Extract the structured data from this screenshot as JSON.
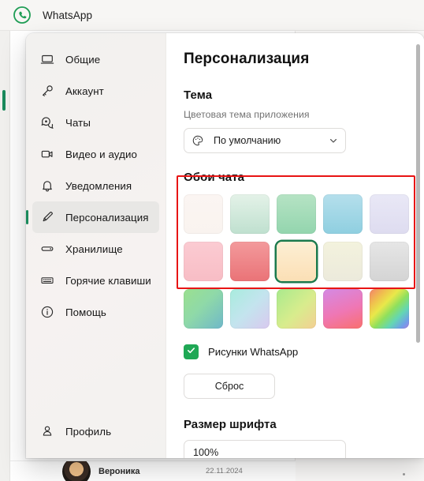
{
  "window": {
    "app_title": "WhatsApp",
    "logo_icon": "whatsapp-logo-icon"
  },
  "background": {
    "chat_name": "Вероника",
    "chat_date": "22.11.2024"
  },
  "sidebar": {
    "items": [
      {
        "label": "Общие",
        "icon": "laptop-icon",
        "active": false
      },
      {
        "label": "Аккаунт",
        "icon": "key-icon",
        "active": false
      },
      {
        "label": "Чаты",
        "icon": "chats-icon",
        "active": false
      },
      {
        "label": "Видео и аудио",
        "icon": "video-icon",
        "active": false
      },
      {
        "label": "Уведомления",
        "icon": "bell-icon",
        "active": false
      },
      {
        "label": "Персонализация",
        "icon": "brush-icon",
        "active": true
      },
      {
        "label": "Хранилище",
        "icon": "storage-icon",
        "active": false
      },
      {
        "label": "Горячие клавиши",
        "icon": "keyboard-icon",
        "active": false
      },
      {
        "label": "Помощь",
        "icon": "info-icon",
        "active": false
      }
    ],
    "profile": {
      "label": "Профиль",
      "icon": "person-icon"
    }
  },
  "content": {
    "page_title": "Персонализация",
    "theme": {
      "title": "Тема",
      "subtitle": "Цветовая тема приложения",
      "selected": "По умолчанию",
      "icon": "palette-icon",
      "caret": "chevron-down-icon"
    },
    "wallpaper": {
      "title": "Обои чата",
      "highlight_color": "#e81414",
      "selected_index": 7,
      "selected_outline": "#1b7a4d",
      "swatches": [
        {
          "name": "wallpaper-cream",
          "css": "linear-gradient(180deg,#fbf5f2 0%,#f9f3ef 100%)"
        },
        {
          "name": "wallpaper-mint",
          "css": "linear-gradient(180deg,#e4f2e8 0%,#bfe0cf 100%)"
        },
        {
          "name": "wallpaper-green",
          "css": "linear-gradient(180deg,#b6e3c4 0%,#93d5ae 100%)"
        },
        {
          "name": "wallpaper-sky",
          "css": "linear-gradient(180deg,#b5dfec 0%,#8fcfe0 100%)"
        },
        {
          "name": "wallpaper-lavender",
          "css": "linear-gradient(180deg,#e9e8f6 0%,#dedcf0 100%)"
        },
        {
          "name": "wallpaper-pink",
          "css": "linear-gradient(180deg,#fbcbd2 0%,#f8bdc5 100%)"
        },
        {
          "name": "wallpaper-coral",
          "css": "linear-gradient(180deg,#f39a9c 0%,#ea7377 100%)"
        },
        {
          "name": "wallpaper-peach",
          "css": "linear-gradient(180deg,#fdefd4 0%,#fbdfb5 100%)"
        },
        {
          "name": "wallpaper-ivory",
          "css": "linear-gradient(180deg,#f3f2dd 0%,#eceadc 100%)"
        },
        {
          "name": "wallpaper-grey",
          "css": "linear-gradient(180deg,#e6e6e6 0%,#d4d4d4 100%)"
        },
        {
          "name": "wallpaper-green-blue",
          "css": "linear-gradient(135deg,#9be08f 0%,#8fd9a8 45%,#6fb8c9 100%)"
        },
        {
          "name": "wallpaper-aqua-lilac",
          "css": "linear-gradient(135deg,#a8ecdd 0%,#c3e4ee 50%,#d9c9ef 100%)"
        },
        {
          "name": "wallpaper-lime-peach",
          "css": "linear-gradient(135deg,#a9ea8d 0%,#d8ec8d 55%,#f4cf93 100%)"
        },
        {
          "name": "wallpaper-magenta-rose",
          "css": "linear-gradient(160deg,#d48ae4 0%,#ef77b4 55%,#f9706e 100%)"
        },
        {
          "name": "wallpaper-rainbow",
          "css": "linear-gradient(135deg,#f4836a 0%,#f0c04e 22%,#e9e84a 38%,#8fe05c 55%,#63d6b4 72%,#6f9fe8 88%,#a87fe0 100%)"
        }
      ]
    },
    "whatsapp_doodles": {
      "label": "Рисунки WhatsApp",
      "checked": true,
      "check_icon": "checkmark-icon",
      "color": "#1fa855"
    },
    "reset_button": "Сброс",
    "font_size": {
      "title": "Размер шрифта",
      "selected": "100%"
    }
  }
}
